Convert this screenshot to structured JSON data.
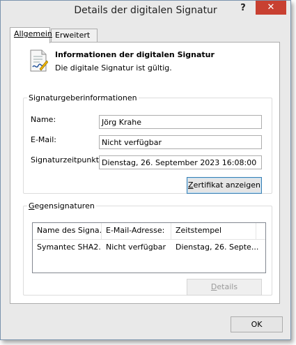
{
  "window": {
    "title": "Details der digitalen Signatur",
    "help_label": "?",
    "close_label": "✕"
  },
  "tabs": [
    {
      "label": "Allgemein",
      "active": true
    },
    {
      "label": "Erweitert",
      "active": false
    }
  ],
  "info": {
    "title": "Informationen der digitalen Signatur",
    "status": "Die digitale Signatur ist gültig."
  },
  "signer": {
    "legend": "Signaturgeberinformationen",
    "name_label": "Name:",
    "name_value": "Jörg Krahe",
    "email_label": "E-Mail:",
    "email_value": "Nicht verfügbar",
    "time_label": "Signaturzeitpunkt:",
    "time_value": "Dienstag, 26. September 2023 16:08:00",
    "cert_button_pre": "Z",
    "cert_button_rest": "ertifikat anzeigen"
  },
  "countersign": {
    "legend_pre": "G",
    "legend_rest": "egensignaturen",
    "columns": [
      "Name des Signa...",
      "E-Mail-Adresse:",
      "Zeitstempel"
    ],
    "rows": [
      [
        "Symantec SHA2...",
        "Nicht verfügbar",
        "Dienstag, 26. Septe..."
      ]
    ],
    "details_pre": "D",
    "details_rest": "etails"
  },
  "footer": {
    "ok_label": "OK"
  },
  "colors": {
    "close_button": "#c84031",
    "frame_border": "#7a93ad",
    "focus_border": "#3c7fb1"
  },
  "icons": [
    "signature-document-icon",
    "help-icon",
    "close-icon"
  ]
}
